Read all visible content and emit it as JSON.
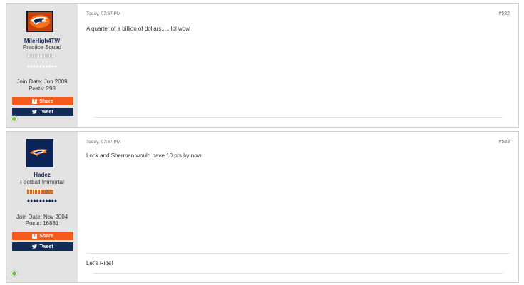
{
  "posts": [
    {
      "username": "MileHigh4TW",
      "user_title": "Practice Squad",
      "rank_level": "white",
      "reputation_dots": "●●●●●●●●●●",
      "join_date": "Join Date: Jun 2009",
      "posts_count": "Posts: 298",
      "share_label": "Share",
      "tweet_label": "Tweet",
      "date": "Today, 07:37 PM",
      "post_number": "#582",
      "message": "A quarter of a billion of dollars..... lol wow",
      "signature": ""
    },
    {
      "username": "Hadez",
      "user_title": "Football Immortal",
      "rank_level": "orange",
      "reputation_dots": "●●●●●●●●●●",
      "join_date": "Join Date: Nov 2004",
      "posts_count": "Posts: 16881",
      "share_label": "Share",
      "tweet_label": "Tweet",
      "date": "Today, 07:37 PM",
      "post_number": "#583",
      "message": "Lock and Sherman would have 10 pts by now",
      "signature": "Let's Ride!"
    }
  ],
  "icons": {
    "facebook": "facebook-icon",
    "twitter": "twitter-icon",
    "online": "online-status-icon"
  },
  "colors": {
    "share": "#f45b1d",
    "tweet": "#132c57",
    "online": "#74c043",
    "rank_orange": "#f47a20",
    "broncos_navy": "#0c2358"
  }
}
